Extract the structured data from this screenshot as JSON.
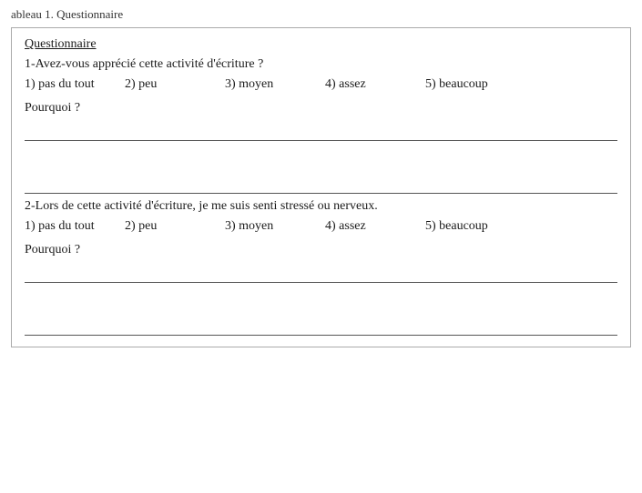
{
  "page": {
    "title": "ableau 1. Questionnaire",
    "section_label": "Questionnaire",
    "questions": [
      {
        "id": "q1",
        "text": "1-Avez-vous apprécié cette activité d'écriture ?",
        "options": [
          "1) pas du tout",
          "2) peu",
          "3) moyen",
          "4) assez",
          "5) beaucoup"
        ],
        "pourquoi_label": "Pourquoi ?"
      },
      {
        "id": "q2",
        "text": "2-Lors de cette activité d'écriture, je me suis senti stressé ou nerveux.",
        "options": [
          "1) pas du tout",
          "2) peu",
          "3) moyen",
          "4) assez",
          "5) beaucoup"
        ],
        "pourquoi_label": "Pourquoi ?"
      }
    ]
  }
}
